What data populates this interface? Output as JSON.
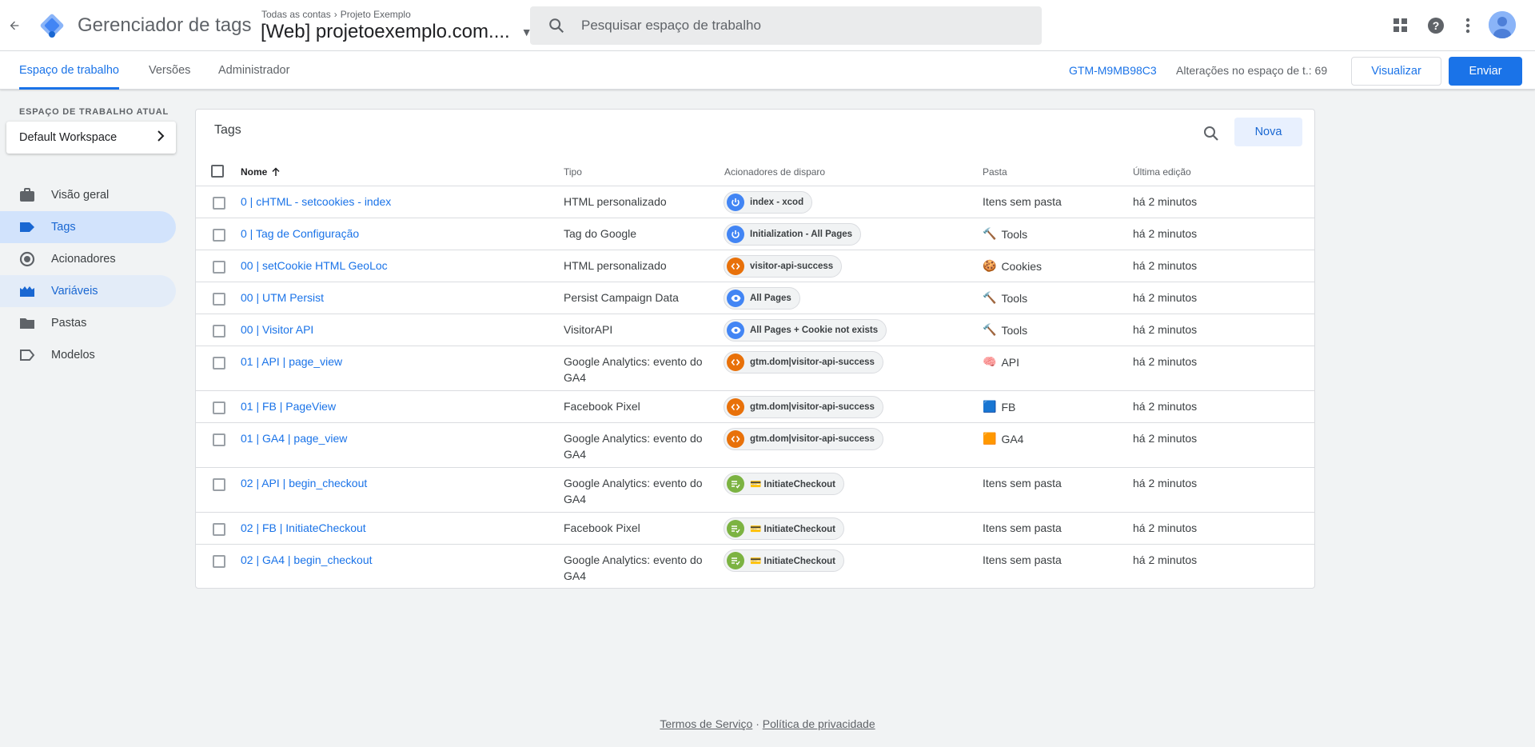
{
  "app": {
    "title": "Gerenciador de tags",
    "breadcrumb": [
      "Todas as contas",
      "Projeto Exemplo"
    ],
    "container_name": "[Web] projetoexemplo.com....",
    "search_placeholder": "Pesquisar espaço de trabalho"
  },
  "tabs": [
    {
      "label": "Espaço de trabalho",
      "active": true
    },
    {
      "label": "Versões",
      "active": false
    },
    {
      "label": "Administrador",
      "active": false
    }
  ],
  "toolbar": {
    "container_id": "GTM-M9MB98C3",
    "changes_label": "Alterações no espaço de t.: 69",
    "preview_label": "Visualizar",
    "submit_label": "Enviar"
  },
  "sidebar": {
    "workspace_heading": "ESPAÇO DE TRABALHO ATUAL",
    "workspace_name": "Default Workspace",
    "items": [
      {
        "label": "Visão geral",
        "icon": "briefcase-icon"
      },
      {
        "label": "Tags",
        "icon": "tag-icon",
        "active": true
      },
      {
        "label": "Acionadores",
        "icon": "trigger-icon"
      },
      {
        "label": "Variáveis",
        "icon": "variables-icon",
        "hover": true
      },
      {
        "label": "Pastas",
        "icon": "folder-icon"
      },
      {
        "label": "Modelos",
        "icon": "template-icon"
      }
    ]
  },
  "tags_card": {
    "title": "Tags",
    "new_label": "Nova",
    "columns": [
      "Nome",
      "Tipo",
      "Acionadores de disparo",
      "Pasta",
      "Última edição"
    ],
    "rows": [
      {
        "name": "0 | cHTML - setcookies - index",
        "type": "HTML personalizado",
        "trigger": "index - xcod",
        "trigger_kind": "init",
        "folder": "Itens sem pasta",
        "folder_icon": "",
        "edited": "há 2 minutos"
      },
      {
        "name": "0 | Tag de Configuração",
        "type": "Tag do Google",
        "trigger": "Initialization - All Pages",
        "trigger_kind": "init",
        "folder": "Tools",
        "folder_icon": "🔨",
        "edited": "há 2 minutos"
      },
      {
        "name": "00 | setCookie HTML GeoLoc",
        "type": "HTML personalizado",
        "trigger": "visitor-api-success",
        "trigger_kind": "custom",
        "folder": "Cookies",
        "folder_icon": "🍪",
        "edited": "há 2 minutos"
      },
      {
        "name": "00 | UTM Persist",
        "type": "Persist Campaign Data",
        "trigger": "All Pages",
        "trigger_kind": "pageview",
        "folder": "Tools",
        "folder_icon": "🔨",
        "edited": "há 2 minutos"
      },
      {
        "name": "00 | Visitor API",
        "type": "VisitorAPI",
        "trigger": "All Pages + Cookie not exists",
        "trigger_kind": "pageview",
        "folder": "Tools",
        "folder_icon": "🔨",
        "edited": "há 2 minutos"
      },
      {
        "name": "01 | API | page_view",
        "type": "Google Analytics: evento do GA4",
        "trigger": "gtm.dom|visitor-api-success",
        "trigger_kind": "custom",
        "folder": "API",
        "folder_icon": "🧠",
        "edited": "há 2 minutos"
      },
      {
        "name": "01 | FB | PageView",
        "type": "Facebook Pixel",
        "trigger": "gtm.dom|visitor-api-success",
        "trigger_kind": "custom",
        "folder": "FB",
        "folder_icon": "🟦",
        "edited": "há 2 minutos"
      },
      {
        "name": "01 | GA4 | page_view",
        "type": "Google Analytics: evento do GA4",
        "trigger": "gtm.dom|visitor-api-success",
        "trigger_kind": "custom",
        "folder": "GA4",
        "folder_icon": "🟧",
        "edited": "há 2 minutos"
      },
      {
        "name": "02 | API | begin_checkout",
        "type": "Google Analytics: evento do GA4",
        "trigger": "💳 InitiateCheckout",
        "trigger_kind": "datalayer",
        "folder": "Itens sem pasta",
        "folder_icon": "",
        "edited": "há 2 minutos"
      },
      {
        "name": "02 | FB | InitiateCheckout",
        "type": "Facebook Pixel",
        "trigger": "💳 InitiateCheckout",
        "trigger_kind": "datalayer",
        "folder": "Itens sem pasta",
        "folder_icon": "",
        "edited": "há 2 minutos"
      },
      {
        "name": "02 | GA4 | begin_checkout",
        "type": "Google Analytics: evento do GA4",
        "trigger": "💳 InitiateCheckout",
        "trigger_kind": "datalayer",
        "folder": "Itens sem pasta",
        "folder_icon": "",
        "edited": "há 2 minutos"
      }
    ]
  },
  "footer": {
    "terms": "Termos de Serviço",
    "separator": "·",
    "privacy": "Política de privacidade"
  },
  "colors": {
    "accent": "#1a73e8",
    "init_trigger": "#4285f4",
    "custom_trigger": "#e8710a",
    "datalayer_trigger": "#7cb342"
  }
}
